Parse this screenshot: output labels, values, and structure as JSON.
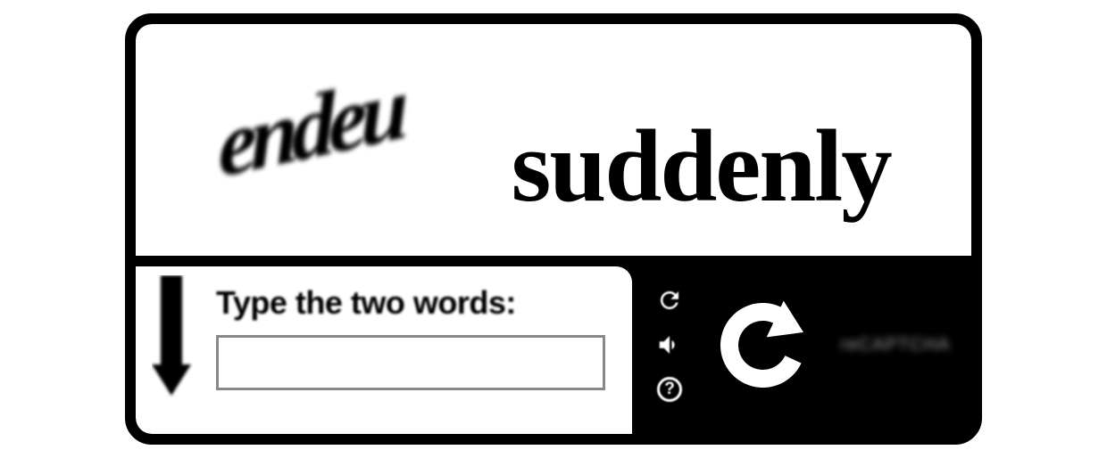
{
  "captcha": {
    "challenge": {
      "distorted_word": "endeu",
      "readable_word": "suddenly"
    },
    "input": {
      "label": "Type the two words:",
      "value": ""
    },
    "controls": {
      "refresh_label": "refresh",
      "audio_label": "audio",
      "help_label": "?"
    },
    "brand": "reCAPTCHA"
  }
}
